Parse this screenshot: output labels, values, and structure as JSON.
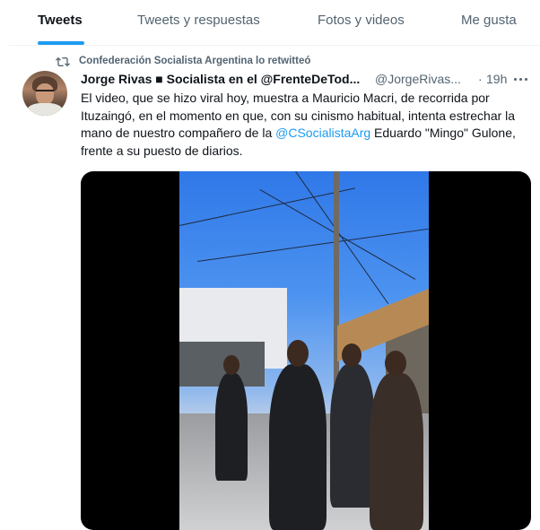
{
  "tabs": [
    {
      "label": "Tweets",
      "active": true
    },
    {
      "label": "Tweets y respuestas",
      "active": false
    },
    {
      "label": "Fotos y videos",
      "active": false
    },
    {
      "label": "Me gusta",
      "active": false
    }
  ],
  "retweet": {
    "text": "Confederación Socialista Argentina lo retwitteó",
    "icon": "retweet-icon"
  },
  "tweet": {
    "author_name": "Jorge Rivas ■ Socialista en el @FrenteDeTod...",
    "handle": "@JorgeRivas...",
    "separator": "·",
    "time": "19h",
    "text_part1": "El video, que se hizo viral hoy, muestra a Mauricio Macri, de recorrida por Ituzaingó, en el momento en que, con su cinismo habitual, intenta estrechar la mano de nuestro compañero de la ",
    "mention": "@CSocialistaArg",
    "text_part2": " Eduardo \"Mingo\" Gulone, frente a su puesto de diarios.",
    "media": {
      "type": "video"
    }
  },
  "colors": {
    "accent": "#1d9bf0",
    "secondary_text": "#536471",
    "primary_text": "#0f1419"
  }
}
